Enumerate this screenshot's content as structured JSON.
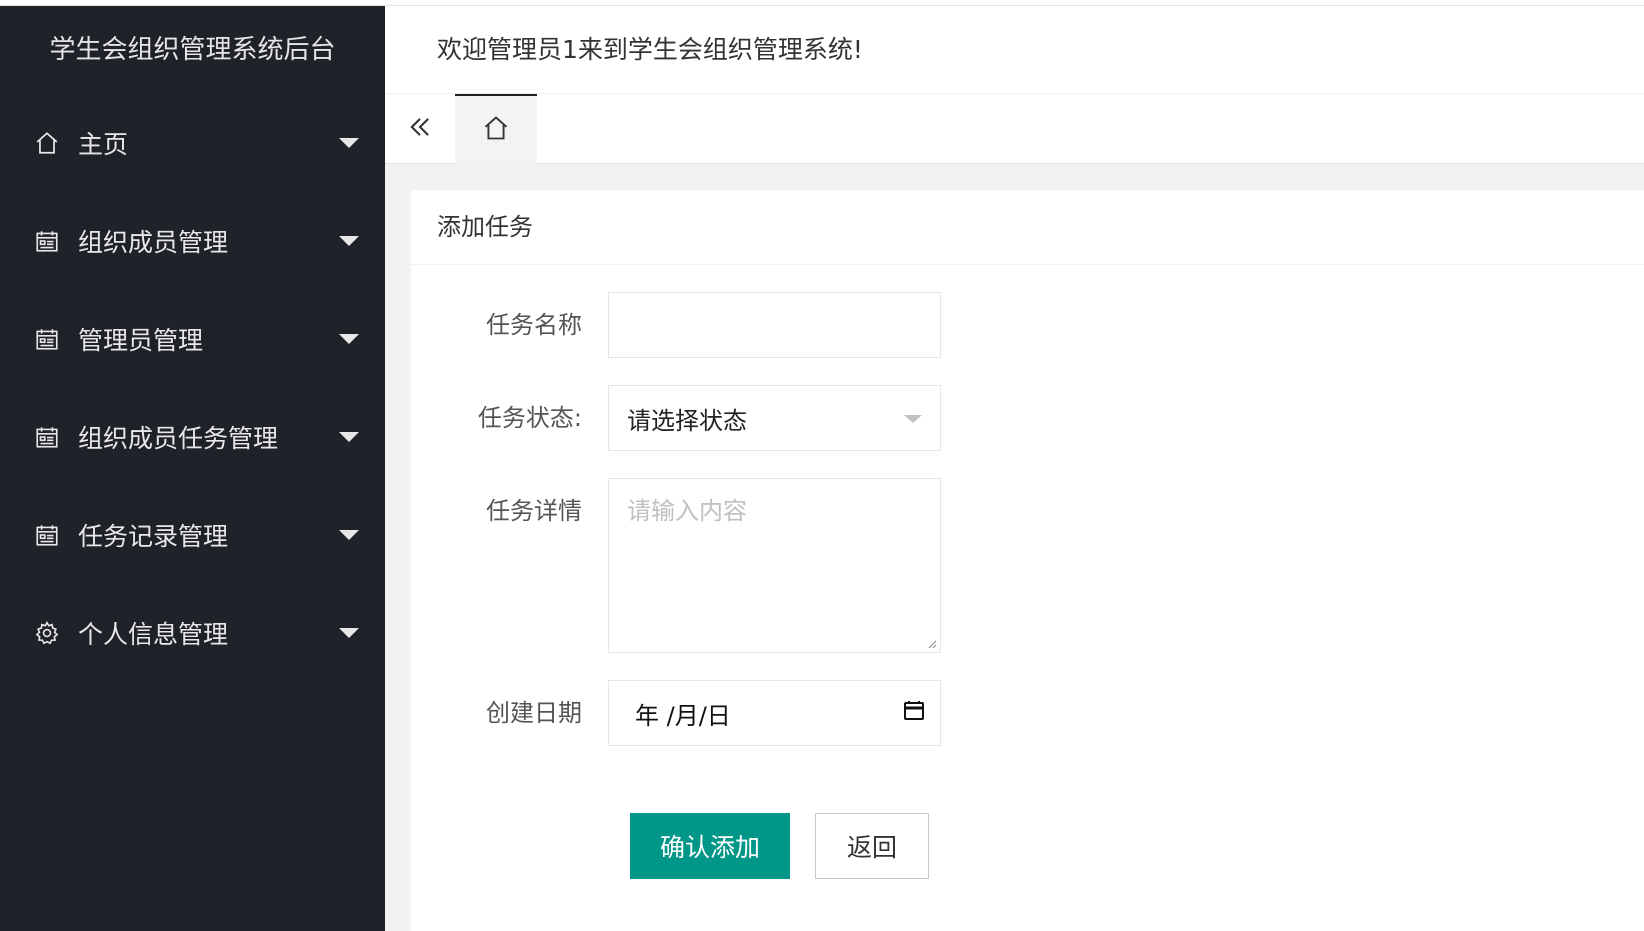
{
  "sidebar": {
    "logo": "学生会组织管理系统后台",
    "items": [
      {
        "label": "主页",
        "icon": "home-icon"
      },
      {
        "label": "组织成员管理",
        "icon": "calendar-icon"
      },
      {
        "label": "管理员管理",
        "icon": "calendar-icon"
      },
      {
        "label": "组织成员任务管理",
        "icon": "calendar-icon"
      },
      {
        "label": "任务记录管理",
        "icon": "calendar-icon"
      },
      {
        "label": "个人信息管理",
        "icon": "gear-icon"
      }
    ]
  },
  "header": {
    "welcome": "欢迎管理员1来到学生会组织管理系统!"
  },
  "tabs": {
    "collapse_icon": "double-chevron-left-icon",
    "home_icon": "home-icon"
  },
  "form": {
    "title": "添加任务",
    "name_label": "任务名称",
    "name_value": "",
    "status_label": "任务状态:",
    "status_value": "请选择状态",
    "detail_label": "任务详情",
    "detail_placeholder": "请输入内容",
    "date_label": "创建日期",
    "date_value": "年 /月/日",
    "submit_label": "确认添加",
    "back_label": "返回"
  },
  "colors": {
    "sidebar_bg": "#20222a",
    "primary": "#009688"
  }
}
